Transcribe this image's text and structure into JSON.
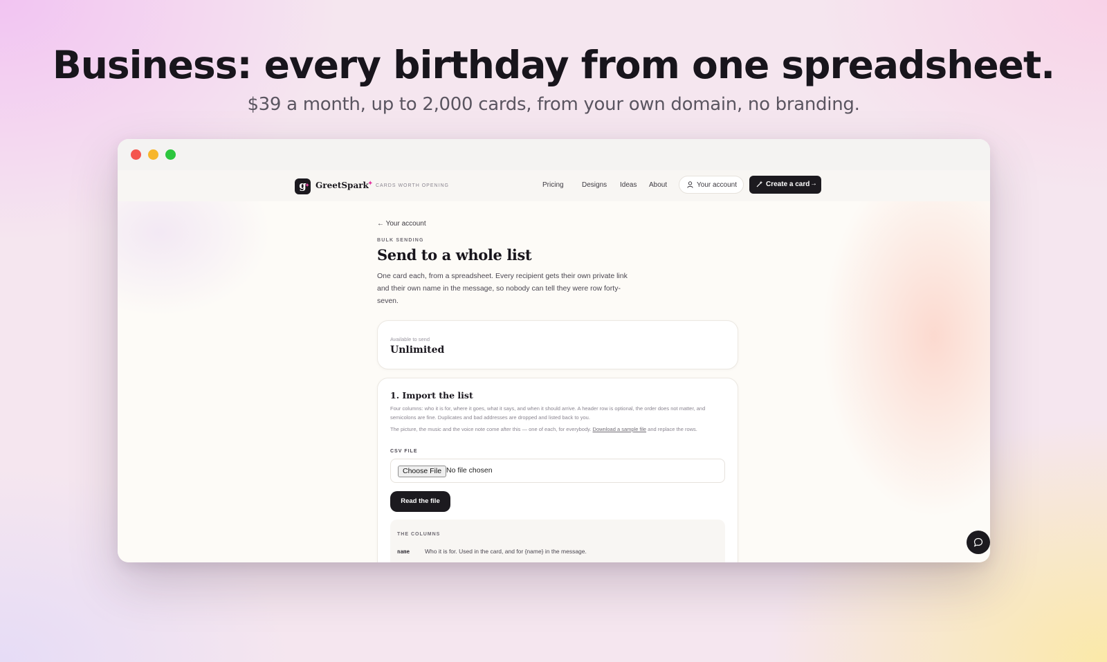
{
  "hero": {
    "title": "Business: every birthday from one spreadsheet.",
    "subtitle": "$39 a month, up to 2,000 cards, from your own domain, no branding."
  },
  "nav": {
    "brand": "GreetSpark",
    "logo_letter": "g",
    "tagline": "CARDS WORTH OPENING",
    "links": [
      "Pricing",
      "Designs",
      "Ideas",
      "About"
    ],
    "account_label": "Your account",
    "create_label": "Create a card"
  },
  "page": {
    "back_link": "← Your account",
    "eyebrow": "BULK SENDING",
    "title": "Send to a whole list",
    "intro": "One card each, from a spreadsheet. Every recipient gets their own private link and their own name in the message, so nobody can tell they were row forty-seven."
  },
  "availability": {
    "label": "Available to send",
    "value": "Unlimited"
  },
  "import": {
    "title": "1. Import the list",
    "desc1": "Four columns: who it is for, where it goes, what it says, and when it should arrive. A header row is optional, the order does not matter, and semicolons are fine. Duplicates and bad addresses are dropped and listed back to you.",
    "desc2_before": "The picture, the music and the voice note come after this — one of each, for everybody.",
    "desc2_link": "Download a sample file",
    "desc2_after": "and replace the rows.",
    "field_label": "CSV FILE",
    "choose_file": "Choose File",
    "file_status": "No file chosen",
    "read_button": "Read the file",
    "columns_title": "THE COLUMNS",
    "columns": [
      {
        "key": "name",
        "desc": "Who it is for. Used in the card, and for {name} in the message."
      }
    ]
  },
  "icons": {
    "user": "user-icon",
    "wand": "magic-wand-icon",
    "arrow": "arrow-right-icon",
    "chat": "chat-bubble-icon"
  },
  "colors": {
    "accent": "#e2359f",
    "dark": "#1c1a1f",
    "traffic_red": "#f4564e",
    "traffic_yellow": "#f7b62b",
    "traffic_green": "#2cc63e"
  }
}
